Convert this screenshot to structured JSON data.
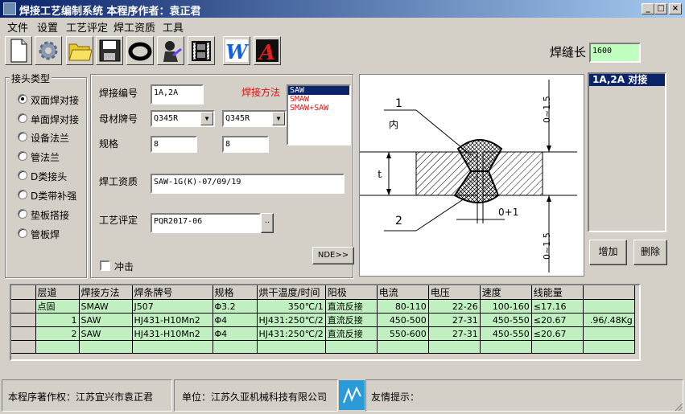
{
  "window": {
    "title": "焊接工艺编制系统   本程序作者：袁正君"
  },
  "menu": [
    "文件",
    "设置",
    "工艺评定",
    "焊工资质",
    "工具"
  ],
  "toolbar": {
    "icons": [
      "new-file-icon",
      "gear-icon",
      "open-folder-icon",
      "save-disk-icon",
      "ring-icon",
      "welder-icon",
      "film-icon",
      "w-logo-icon",
      "a-logo-icon"
    ],
    "w_glyph": "W",
    "a_glyph": "A"
  },
  "weld_length": {
    "label": "焊缝长",
    "value": "1600"
  },
  "joint_type": {
    "title": "接头类型",
    "options": [
      "双面焊对接",
      "单面焊对接",
      "设备法兰",
      "管法兰",
      "D类接头",
      "D类带补强",
      "垫板搭接",
      "管板焊"
    ],
    "selected": 0
  },
  "form": {
    "weld_no_label": "焊接编号",
    "weld_no": "1A,2A",
    "method_label": "焊接方法",
    "methods": [
      "SAW",
      "SMAW",
      "SMAW+SAW"
    ],
    "base_metal_label": "母材牌号",
    "base_metal_1": "Q345R",
    "base_metal_2": "Q345R",
    "spec_label": "规格",
    "spec_1": "8",
    "spec_2": "8",
    "welder_qual_label": "焊工资质",
    "welder_qual": "SAW-1G(K)-07/09/19",
    "pqr_label": "工艺评定",
    "pqr": "PQR2017-06",
    "pqr_btn": "..",
    "punch_label": "冲击",
    "nde_btn": "NDE>>"
  },
  "diagram": {
    "callout_1": "1",
    "callout_2": "2",
    "inner_label": "内",
    "thickness_label": "t",
    "gap_label": "0+1",
    "angle_top": "0~1.5",
    "angle_bottom": "0~1.5"
  },
  "side_list": {
    "items": [
      "1A,2A   对接"
    ]
  },
  "buttons": {
    "add": "增加",
    "delete": "删除"
  },
  "grid": {
    "columns": [
      "层道",
      "焊接方法",
      "焊条牌号",
      "规格",
      "烘干温度/时间",
      "阳极",
      "电流",
      "电压",
      "速度",
      "线能量",
      ""
    ],
    "rows": [
      [
        "点固",
        "SMAW",
        "J507",
        "Φ3.2",
        "350℃/1",
        "直流反接",
        "80-110",
        "22-26",
        "100-160",
        "≤17.16",
        ""
      ],
      [
        "1",
        "SAW",
        "HJ431-H10Mn2",
        "Φ4",
        "HJ431:250℃/2",
        "直流反接",
        "450-500",
        "27-31",
        "450-550",
        "≤20.67",
        ".96/.48Kg"
      ],
      [
        "2",
        "SAW",
        "HJ431-H10Mn2",
        "Φ4",
        "HJ431:250℃/2",
        "直流反接",
        "550-600",
        "27-31",
        "450-550",
        "≤20.67",
        ""
      ],
      [
        "",
        "",
        "",
        "",
        "",
        "",
        "",
        "",
        "",
        "",
        ""
      ]
    ]
  },
  "status": {
    "copyright": "本程序著作权：江苏宜兴市袁正君",
    "company": "单位：江苏久亚机械科技有限公司",
    "hint": "友情提示："
  }
}
